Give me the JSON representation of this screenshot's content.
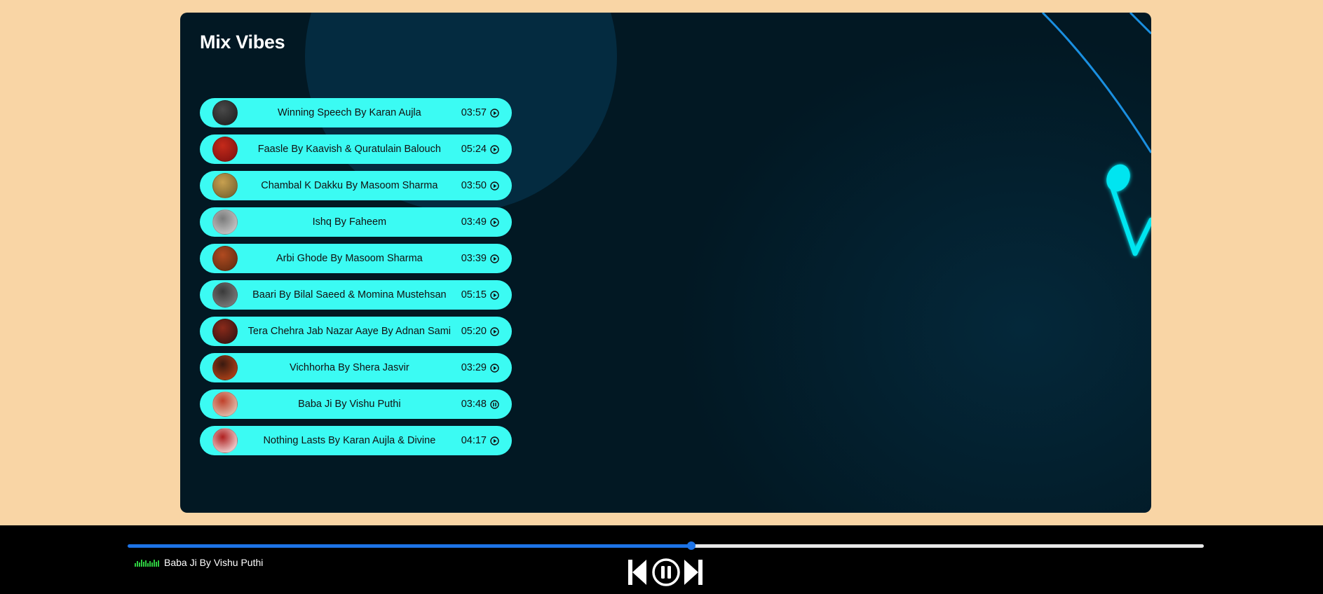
{
  "app": {
    "title": "Mix Vibes"
  },
  "songs": [
    {
      "name": "Winning Speech By Karan Aujla",
      "duration": "03:57",
      "state": "play",
      "cover": [
        "#1a1a1a",
        "#4a4a4a"
      ]
    },
    {
      "name": "Faasle By Kaavish & Quratulain Balouch",
      "duration": "05:24",
      "state": "play",
      "cover": [
        "#7a0f0f",
        "#c42a1a"
      ]
    },
    {
      "name": "Chambal K Dakku By Masoom Sharma",
      "duration": "03:50",
      "state": "play",
      "cover": [
        "#6b5a2a",
        "#c8a050"
      ]
    },
    {
      "name": "Ishq By Faheem",
      "duration": "03:49",
      "state": "play",
      "cover": [
        "#d8d8d8",
        "#7a7a7a"
      ]
    },
    {
      "name": "Arbi Ghode By Masoom Sharma",
      "duration": "03:39",
      "state": "play",
      "cover": [
        "#5a2a10",
        "#b04a20"
      ]
    },
    {
      "name": "Baari By Bilal Saeed & Momina Mustehsan",
      "duration": "05:15",
      "state": "play",
      "cover": [
        "#8a8a8a",
        "#3a3a3a"
      ]
    },
    {
      "name": "Tera Chehra Jab Nazar Aaye By Adnan Sami",
      "duration": "05:20",
      "state": "play",
      "cover": [
        "#2a1010",
        "#8a2a1a"
      ]
    },
    {
      "name": "Vichhorha By Shera Jasvir",
      "duration": "03:29",
      "state": "play",
      "cover": [
        "#c84a1a",
        "#3a1a10"
      ]
    },
    {
      "name": "Baba Ji By Vishu Puthi",
      "duration": "03:48",
      "state": "pause",
      "cover": [
        "#e8e0d0",
        "#c0402a"
      ]
    },
    {
      "name": "Nothing Lasts By Karan Aujla & Divine",
      "duration": "04:17",
      "state": "play",
      "cover": [
        "#ffffff",
        "#b02020"
      ]
    }
  ],
  "player": {
    "now_playing": "Baba Ji By Vishu Puthi",
    "progress_percent": 52.4,
    "state": "playing"
  },
  "icons": {
    "prev": "previous-icon",
    "pause": "pause-icon",
    "next": "next-icon",
    "equalizer": "equalizer-icon",
    "music_note": "music-note-icon"
  },
  "colors": {
    "page_bg": "#f9d5a5",
    "panel_bg": "#021823",
    "song_row": "#3bfbf3",
    "progress": "#1d73e6",
    "equalizer": "#2ecc40",
    "footer_bg": "#000000"
  }
}
